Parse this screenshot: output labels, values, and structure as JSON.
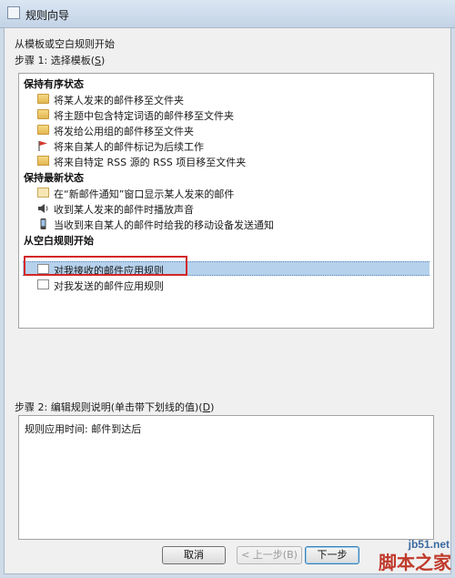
{
  "window": {
    "title": "规则向导"
  },
  "intro": "从模板或空白规则开始",
  "step1_label": "步骤 1: 选择模板(",
  "step1_key": "S",
  "step1_suffix": ")",
  "templates": {
    "groups": [
      {
        "header": "保持有序状态",
        "items": [
          {
            "label": "将某人发来的邮件移至文件夹",
            "icon": "folder-icon"
          },
          {
            "label": "将主题中包含特定词语的邮件移至文件夹",
            "icon": "folder-icon"
          },
          {
            "label": "将发给公用组的邮件移至文件夹",
            "icon": "folder-icon"
          },
          {
            "label": "将来自某人的邮件标记为后续工作",
            "icon": "flag-icon"
          },
          {
            "label": "将来自特定 RSS 源的 RSS 项目移至文件夹",
            "icon": "rss-folder-icon"
          }
        ]
      },
      {
        "header": "保持最新状态",
        "items": [
          {
            "label": "在“新邮件通知”窗口显示某人发来的邮件",
            "icon": "envelope-icon"
          },
          {
            "label": "收到某人发来的邮件时播放声音",
            "icon": "speaker-icon"
          },
          {
            "label": "当收到来自某人的邮件时给我的移动设备发送通知",
            "icon": "phone-icon"
          }
        ]
      },
      {
        "header": "从空白规则开始",
        "items": [
          {
            "label": "对我接收的邮件应用规则",
            "icon": "incoming-rule-icon",
            "selected": true
          },
          {
            "label": "对我发送的邮件应用规则",
            "icon": "outgoing-rule-icon"
          }
        ]
      }
    ]
  },
  "step2_label": "步骤 2: 编辑规则说明(单击带下划线的值)(",
  "step2_key": "D",
  "step2_suffix": ")",
  "description": "规则应用时间: 邮件到达后",
  "buttons": {
    "cancel": "取消",
    "back": "< 上一步(B)",
    "next": "下一步"
  },
  "watermark": {
    "site": "jb51.net",
    "brand": "脚本之家"
  },
  "colors": {
    "selection": "#b6d1ec",
    "highlight_box": "#d32626",
    "titlebar": "#c3d3e6"
  }
}
